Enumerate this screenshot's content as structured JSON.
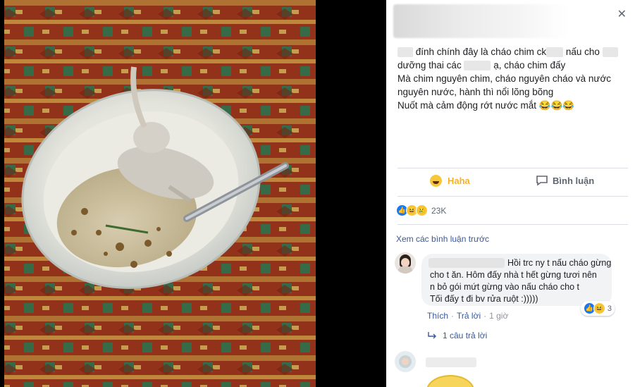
{
  "post": {
    "lines": [
      [
        "",
        "đính chính đây là cháo chim ck",
        "nấu cho",
        ""
      ],
      [
        "dưỡng thai các",
        "ạ, cháo chim đấy"
      ],
      [
        "Mà chim nguyên chim, cháo nguyên cháo và nước"
      ],
      [
        "nguyên nước, hành thì nổi lõng bõng"
      ],
      [
        "Nuốt mà cảm động rớt nước mắt 😂😂😂"
      ]
    ]
  },
  "actions": {
    "haha_label": "Haha",
    "comment_label": "Bình luận"
  },
  "reactions": {
    "count": "23K",
    "types": [
      "like-icon",
      "haha-icon",
      "sad-icon"
    ]
  },
  "comments": {
    "view_previous": "Xem các bình luận trước",
    "first": {
      "lines": [
        "Hồi trc ny t nấu cháo gừng",
        "cho t ăn. Hôm đấy nhà t hết gừng tươi nên",
        "n bỏ gói mứt gừng vào nấu cháo cho t",
        "Tối đấy t đi bv rửa ruột :)))))"
      ],
      "react_count": "3",
      "like_label": "Thích",
      "reply_label": "Trả lời",
      "time": "1 giờ",
      "replies_label": "1 câu trả lời"
    }
  },
  "colors": {
    "link": "#385898",
    "haha": "#f7b125",
    "panel_bg": "#ffffff"
  }
}
